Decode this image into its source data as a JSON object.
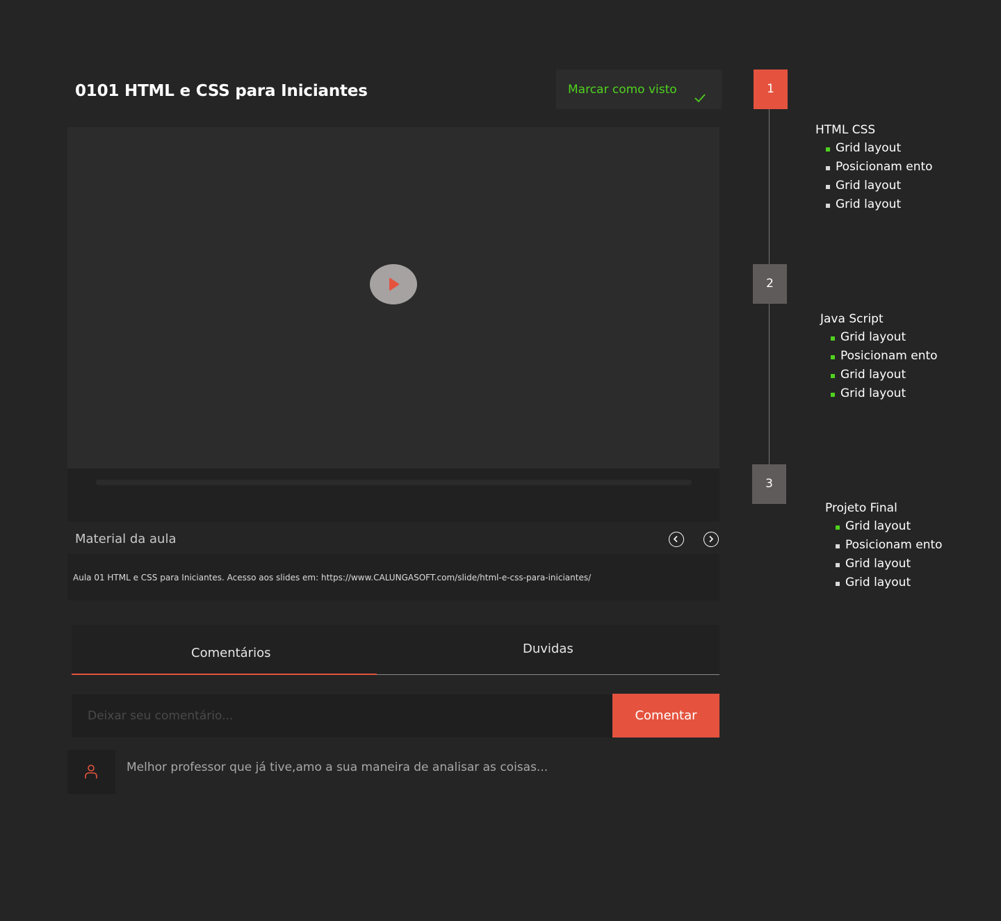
{
  "header": {
    "title": "0101 HTML e CSS para Iniciantes",
    "mark_seen_label": "Marcar como visto"
  },
  "video": {
    "progress": 0
  },
  "material": {
    "label": "Material da aula",
    "description": "Aula 01 HTML e CSS para Iniciantes. Acesso aos slides em: https://www.CALUNGASOFT.com/slide/html-e-css-para-iniciantes/"
  },
  "tabs": [
    {
      "label": "Comentários",
      "active": true
    },
    {
      "label": "Duvidas",
      "active": false
    }
  ],
  "comment_form": {
    "placeholder": "Deixar seu comentário...",
    "button_label": "Comentar"
  },
  "comments": [
    {
      "text": "Melhor professor que já tive,amo a sua maneira de analisar as coisas..."
    }
  ],
  "modules": [
    {
      "number": "1",
      "title": "HTML CSS",
      "active": true,
      "topics": [
        {
          "label": "Grid layout",
          "done": true
        },
        {
          "label": "Posicionam ento",
          "done": false
        },
        {
          "label": "Grid layout",
          "done": false
        },
        {
          "label": "Grid layout",
          "done": false
        }
      ]
    },
    {
      "number": "2",
      "title": "Java Script",
      "active": false,
      "topics": [
        {
          "label": "Grid layout",
          "done": true
        },
        {
          "label": "Posicionam ento",
          "done": true
        },
        {
          "label": "Grid layout",
          "done": true
        },
        {
          "label": "Grid layout",
          "done": true
        }
      ]
    },
    {
      "number": "3",
      "title": "Projeto Final",
      "active": false,
      "topics": [
        {
          "label": "Grid layout",
          "done": true
        },
        {
          "label": "Posicionam ento",
          "done": false
        },
        {
          "label": "Grid layout",
          "done": false
        },
        {
          "label": "Grid layout",
          "done": false
        }
      ]
    }
  ],
  "colors": {
    "accent": "#e5533f",
    "done": "#4fd21e",
    "pending": "#d9d9d9",
    "step_inactive": "#5f5b5a"
  }
}
